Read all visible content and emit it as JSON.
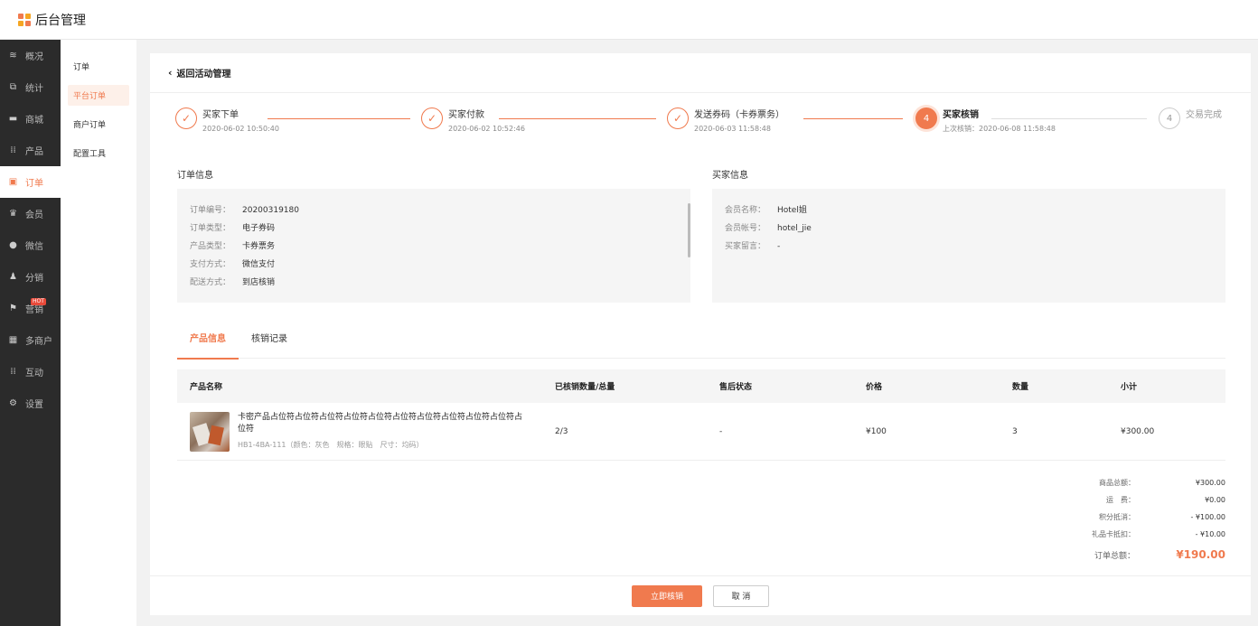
{
  "app": {
    "title": "后台管理",
    "logo_colors": [
      "#f07a4e",
      "#f5a623",
      "#f07a4e",
      "#f5a623"
    ]
  },
  "sidebar": {
    "items": [
      {
        "label": "概况",
        "icon": "layers-icon"
      },
      {
        "label": "统计",
        "icon": "chart-icon"
      },
      {
        "label": "商城",
        "icon": "store-icon"
      },
      {
        "label": "产品",
        "icon": "grid-icon"
      },
      {
        "label": "订单",
        "icon": "clipboard-icon",
        "active": true
      },
      {
        "label": "会员",
        "icon": "crown-icon"
      },
      {
        "label": "微信",
        "icon": "wechat-icon"
      },
      {
        "label": "分销",
        "icon": "users-icon"
      },
      {
        "label": "营销",
        "icon": "flag-icon",
        "badge": "HOT"
      },
      {
        "label": "多商户",
        "icon": "shop-icon"
      },
      {
        "label": "互动",
        "icon": "apps-icon"
      },
      {
        "label": "设置",
        "icon": "gear-icon"
      }
    ]
  },
  "submenu": {
    "items": [
      "订单",
      "平台订单",
      "商户订单",
      "配置工具"
    ],
    "active_index": 1
  },
  "page": {
    "back_label": "返回活动管理"
  },
  "steps": [
    {
      "title": "买家下单",
      "time": "2020-06-02 10:50:40",
      "state": "done"
    },
    {
      "title": "买家付款",
      "time": "2020-06-02 10:52:46",
      "state": "done"
    },
    {
      "title": "发送券码（卡券票务）",
      "time": "2020-06-03 11:58:48",
      "state": "done"
    },
    {
      "number": "4",
      "title": "买家核销",
      "time": "上次核销：2020-06-08 11:58:48",
      "state": "current"
    },
    {
      "number": "4",
      "title": "交易完成",
      "time": "",
      "state": "pending"
    }
  ],
  "order_info": {
    "title": "订单信息",
    "rows": [
      {
        "label": "订单编号：",
        "value": "20200319180"
      },
      {
        "label": "订单类型：",
        "value": "电子券码"
      },
      {
        "label": "产品类型：",
        "value": "卡券票务"
      },
      {
        "label": "支付方式：",
        "value": "微信支付"
      },
      {
        "label": "配送方式：",
        "value": "到店核销"
      }
    ]
  },
  "buyer_info": {
    "title": "买家信息",
    "rows": [
      {
        "label": "会员名称：",
        "value": "Hotel姐"
      },
      {
        "label": "会员帐号：",
        "value": "hotel_jie"
      },
      {
        "label": "买家留言：",
        "value": "-"
      }
    ]
  },
  "tabs": [
    "产品信息",
    "核销记录"
  ],
  "table": {
    "headers": [
      "产品名称",
      "已核销数量/总量",
      "售后状态",
      "价格",
      "数量",
      "小计"
    ],
    "rows": [
      {
        "name": "卡密产品占位符占位符占位符占位符占位符占位符占位符占位符占位符占位符占位符",
        "spec": "HB1-4BA-111（颜色：灰色　规格：眼贴　尺寸：均码）",
        "redeemed": "2/3",
        "after_sale": "-",
        "price": "¥100",
        "qty": "3",
        "subtotal": "¥300.00"
      }
    ]
  },
  "totals": {
    "rows": [
      {
        "label": "商品总额：",
        "value": "¥300.00"
      },
      {
        "label": "运　费：",
        "value": "¥0.00"
      },
      {
        "label": "积分抵消：",
        "value": "- ¥100.00"
      },
      {
        "label": "礼品卡抵扣：",
        "value": "- ¥10.00"
      }
    ],
    "final_label": "订单总额：",
    "final_value": "¥190.00"
  },
  "actions": {
    "confirm": "立即核销",
    "cancel": "取 消"
  },
  "colors": {
    "accent": "#f07a4e",
    "sidebar_bg": "#2b2b2b"
  }
}
